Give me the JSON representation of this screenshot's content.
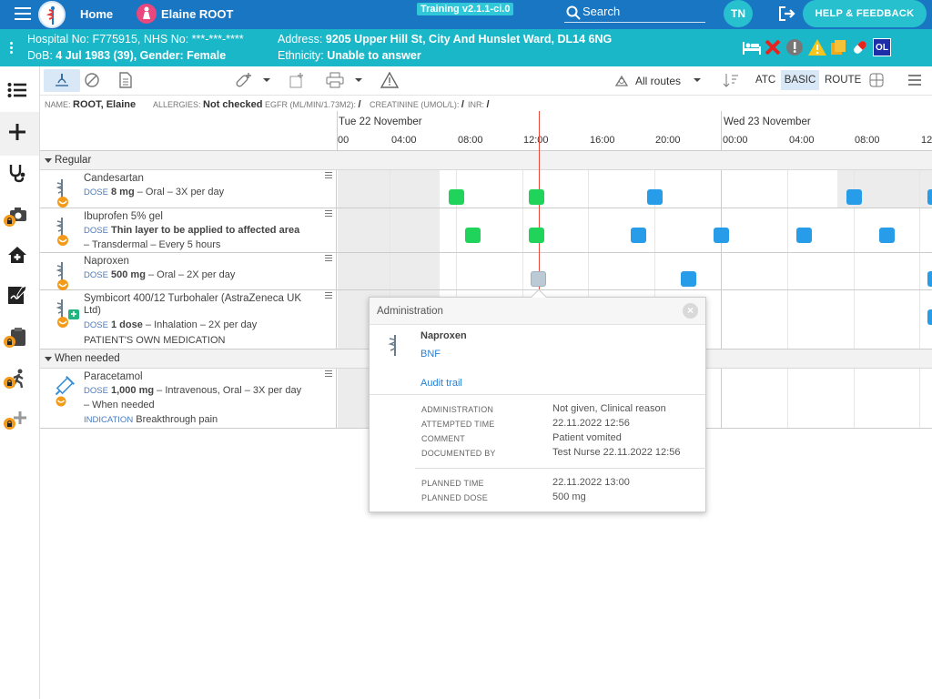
{
  "topbar": {
    "home_label": "Home",
    "patient_name": "Elaine ROOT",
    "training_badge": "Training v2.1.1-ci.0",
    "search_label": "Search",
    "user_initials": "TN",
    "help_label": "HELP & FEEDBACK"
  },
  "patient_banner": {
    "hospital_no": "Hospital No: F775915, NHS No: ***-***-****",
    "dob_prefix": "DoB: ",
    "dob_value": "4 Jul 1983 (39), Gender: Female",
    "address_prefix": "Address: ",
    "address_value": "9205 Upper Hill St, City And Hunslet Ward, DL14 6NG",
    "ethnicity_prefix": "Ethnicity: ",
    "ethnicity_value": "Unable to answer",
    "ol_badge": "OL"
  },
  "toolbar": {
    "routes_label": "All routes",
    "atc_label": "ATC",
    "basic_label": "BASIC",
    "route_label": "ROUTE"
  },
  "infobar": {
    "name_label": "NAME:",
    "name_value": "ROOT, Elaine",
    "allergies_label": "ALLERGIES:",
    "allergies_value": "Not checked",
    "egfr_label": "EGFR (ML/MIN/1.73M2):",
    "egfr_value": "/",
    "creatinine_label": "CREATININE (UMOL/L):",
    "creatinine_value": "/",
    "inr_label": "INR:",
    "inr_value": "/"
  },
  "timeline": {
    "day1": "Tue 22 November",
    "day2": "Wed 23 November",
    "times": [
      "00",
      "04:00",
      "08:00",
      "12:00",
      "16:00",
      "20:00",
      "00:00",
      "04:00",
      "08:00",
      "12"
    ]
  },
  "groups": {
    "regular": "Regular",
    "when_needed": "When needed"
  },
  "dose_label": "DOSE",
  "meds": [
    {
      "name": "Candesartan",
      "dose": "8 mg",
      "detail": " – Oral – 3X per day"
    },
    {
      "name": "Ibuprofen 5% gel",
      "dose": "Thin layer to be applied to affected area",
      "detail2": "– Transdermal – Every 5 hours"
    },
    {
      "name": "Naproxen",
      "dose": "500 mg",
      "detail": " – Oral – 2X per day"
    },
    {
      "name": "Symbicort 400/12 Turbohaler (AstraZeneca UK",
      "name2": "Ltd)",
      "dose": "1 dose",
      "detail": " – Inhalation – 2X per day",
      "note": "PATIENT'S OWN MEDICATION"
    },
    {
      "name": "Paracetamol",
      "dose": "1,000 mg",
      "detail": " – Intravenous, Oral – 3X per day",
      "detail2": "– When needed",
      "indication_label": "INDICATION",
      "indication": "Breakthrough pain"
    }
  ],
  "popup": {
    "title": "Administration",
    "drug": "Naproxen",
    "bnf": "BNF",
    "audit": "Audit trail",
    "rows": [
      {
        "k": "ADMINISTRATION",
        "v": "Not given, Clinical reason"
      },
      {
        "k": "ATTEMPTED TIME",
        "v": "22.11.2022 12:56"
      },
      {
        "k": "COMMENT",
        "v": "Patient vomited"
      },
      {
        "k": "DOCUMENTED BY",
        "v": "Test Nurse 22.11.2022 12:56"
      },
      {
        "k": "PLANNED TIME",
        "v": "22.11.2022 13:00"
      },
      {
        "k": "PLANNED DOSE",
        "v": "500 mg"
      }
    ]
  }
}
